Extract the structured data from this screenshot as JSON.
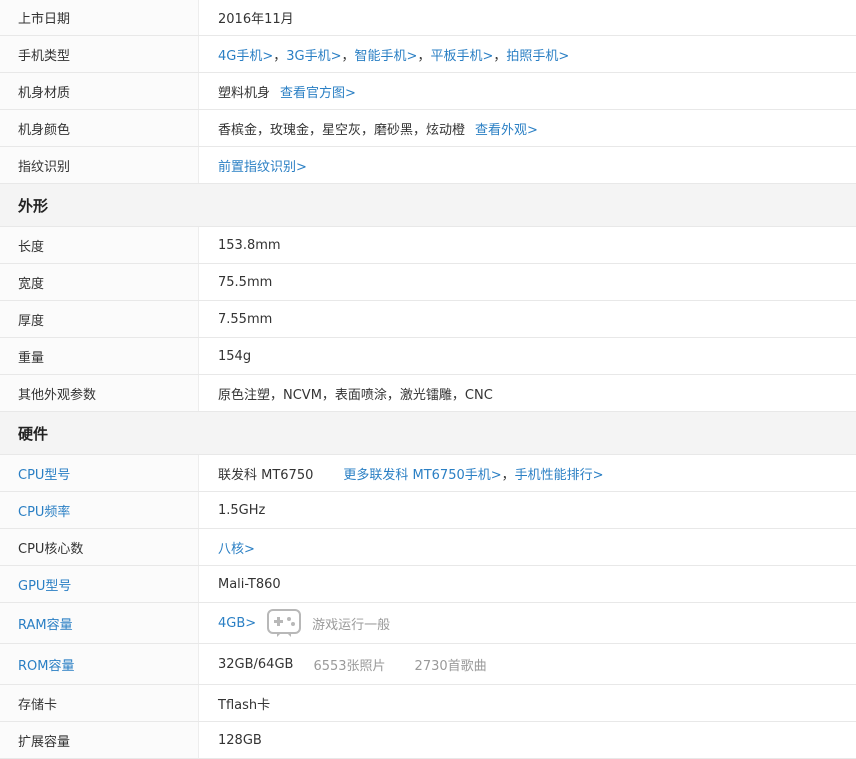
{
  "basic": {
    "release": {
      "label": "上市日期",
      "value": "2016年11月"
    },
    "type": {
      "label": "手机类型",
      "links": [
        "4G手机>",
        "3G手机>",
        "智能手机>",
        "平板手机>",
        "拍照手机>"
      ],
      "separator": "，"
    },
    "material": {
      "label": "机身材质",
      "value": "塑料机身",
      "link": "查看官方图>"
    },
    "color": {
      "label": "机身颜色",
      "value": "香槟金，玫瑰金，星空灰，磨砂黑，炫动橙",
      "link": "查看外观>"
    },
    "fingerprint": {
      "label": "指纹识别",
      "link": "前置指纹识别>"
    }
  },
  "appearance": {
    "title": "外形",
    "rows": [
      {
        "label": "长度",
        "value": "153.8mm"
      },
      {
        "label": "宽度",
        "value": "75.5mm"
      },
      {
        "label": "厚度",
        "value": "7.55mm"
      },
      {
        "label": "重量",
        "value": "154g"
      },
      {
        "label": "其他外观参数",
        "value": "原色注塑，NCVM，表面喷涂，激光镭雕，CNC"
      }
    ]
  },
  "hardware": {
    "title": "硬件",
    "cpu_model": {
      "label": "CPU型号",
      "value": "联发科 MT6750",
      "link_more": "更多联发科 MT6750手机>",
      "sep": "，",
      "link_rank": "手机性能排行>"
    },
    "cpu_freq": {
      "label": "CPU频率",
      "value": "1.5GHz"
    },
    "cpu_cores": {
      "label": "CPU核心数",
      "link": "八核>"
    },
    "gpu": {
      "label": "GPU型号",
      "value": "Mali-T860"
    },
    "ram": {
      "label": "RAM容量",
      "link": "4GB>",
      "icon": "gamepad-icon",
      "note": "游戏运行一般"
    },
    "rom": {
      "label": "ROM容量",
      "value": "32GB/64GB",
      "photos": "6553张照片",
      "songs": "2730首歌曲"
    },
    "storage_card": {
      "label": "存储卡",
      "value": "Tflash卡"
    },
    "expansion": {
      "label": "扩展容量",
      "value": "128GB"
    }
  },
  "colors": {
    "link": "#2a7fc4",
    "muted": "#9a9a9a",
    "section_bg": "#f4f4f4"
  }
}
